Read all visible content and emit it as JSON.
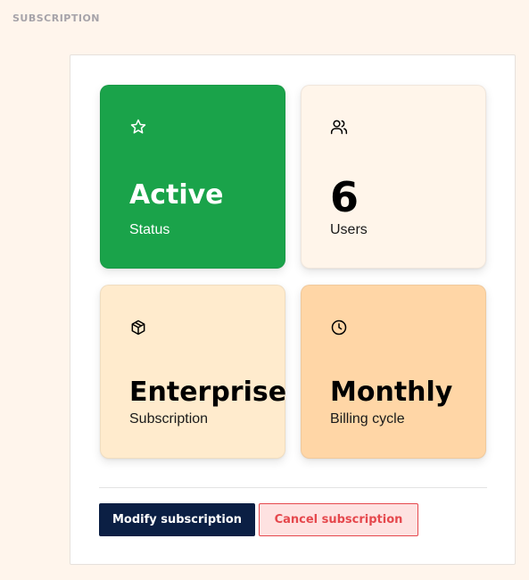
{
  "section": {
    "title": "SUBSCRIPTION"
  },
  "cards": [
    {
      "value": "Active",
      "label": "Status",
      "icon": "star-icon",
      "color": "#1aa34a"
    },
    {
      "value": "6",
      "label": "Users",
      "icon": "users-icon",
      "color": "#fff5ea"
    },
    {
      "value": "Enterprise",
      "label": "Subscription",
      "icon": "box-icon",
      "color": "#ffebcd"
    },
    {
      "value": "Monthly",
      "label": "Billing cycle",
      "icon": "clock-icon",
      "color": "#ffd6a6"
    }
  ],
  "actions": {
    "modify_label": "Modify subscription",
    "cancel_label": "Cancel subscription"
  },
  "colors": {
    "page_background": "#fff5ec",
    "primary_button": "#0b1f44",
    "danger": "#e5484d",
    "danger_background": "#fee2e1"
  }
}
